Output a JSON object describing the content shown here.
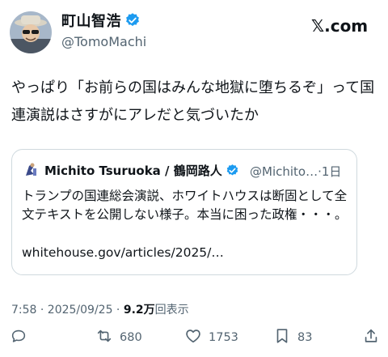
{
  "author": {
    "display_name": "町山智浩",
    "handle": "@TomoMachi"
  },
  "brand": "𝕏.com",
  "post_text": "やっぱり「お前らの国はみんな地獄に堕ちるぞ」って国連演説はさすがにアレだと気づいたか",
  "quoted": {
    "display_name": "Michito Tsuruoka / 鶴岡路人",
    "handle_time": "@Michito…·1日",
    "text": "トランプの国連総会演説、ホワイトハウスは断固として全文テキストを公開しない様子。本当に困った政権・・・。",
    "link": "whitehouse.gov/articles/2025/…"
  },
  "timestamp": {
    "time_date": "7:58 · 2025/09/25 · ",
    "views_count": "9.2万",
    "views_label": "回表示"
  },
  "actions": {
    "reply_icon": "reply-icon",
    "retweets": "680",
    "likes": "1753",
    "bookmarks": "83"
  },
  "colors": {
    "verified": "#1d9bf0",
    "muted_text": "#536471",
    "border": "#cfd9de"
  }
}
